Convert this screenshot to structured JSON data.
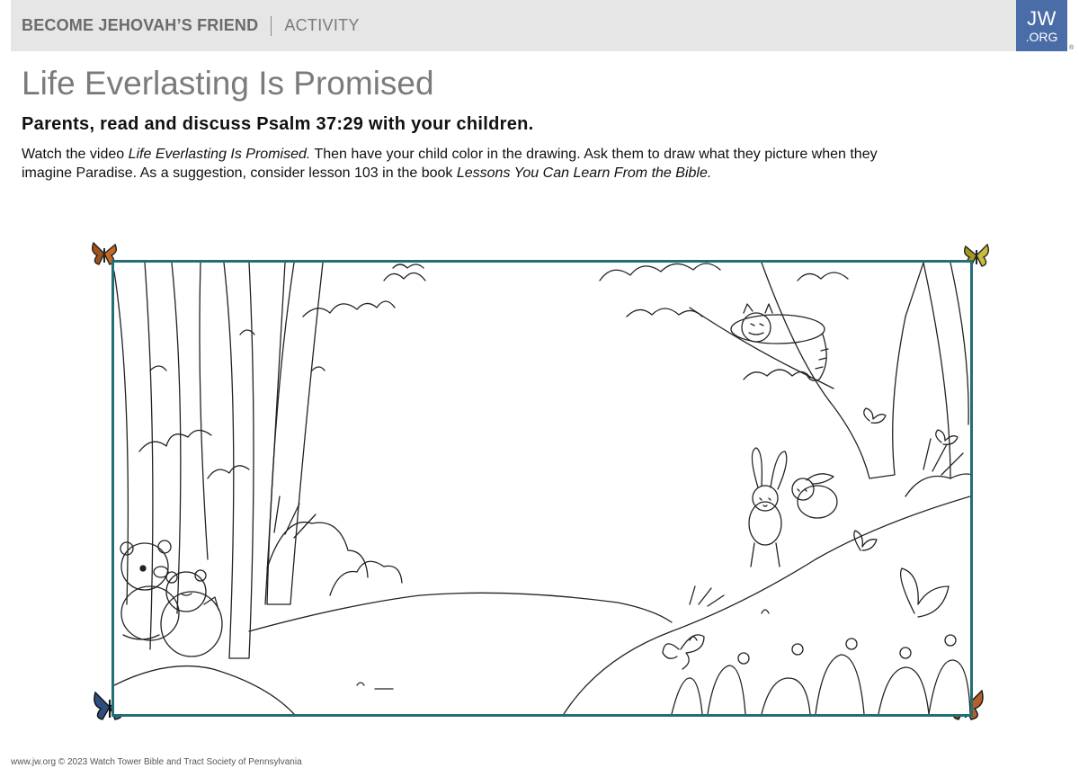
{
  "header": {
    "series": "BECOME JEHOVAH’S FRIEND",
    "section": "ACTIVITY",
    "logo": {
      "line1": "JW",
      "line2": ".ORG",
      "mark": "®",
      "color": "#4a6da7"
    }
  },
  "title": "Life Everlasting Is Promised",
  "subtitle": "Parents, read and discuss Psalm 37:29 with your children.",
  "instructions": {
    "p1": "Watch the video ",
    "video": "Life Everlasting Is Promised.",
    "p2": " Then have your child color in the drawing. Ask them to draw what they picture when they imagine Paradise. As a suggestion, consider lesson 103 in the book ",
    "book": "Lessons You Can Learn From the Bible."
  },
  "illustration": {
    "frame_color": "#236f73",
    "subjects": [
      "bear",
      "bear-cub",
      "raccoon",
      "rabbit",
      "rabbit",
      "butterfly"
    ]
  },
  "footer": "www.jw.org © 2023 Watch Tower Bible and Tract Society of Pennsylvania"
}
